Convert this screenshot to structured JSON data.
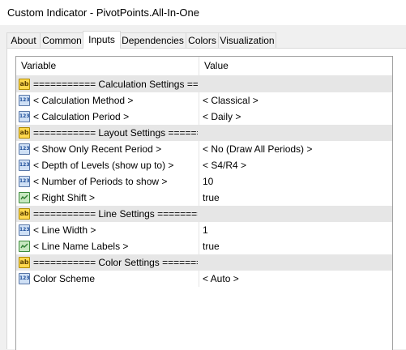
{
  "window": {
    "title": "Custom Indicator - PivotPoints.All-In-One"
  },
  "tabs": [
    {
      "label": "About",
      "active": false
    },
    {
      "label": "Common",
      "active": false
    },
    {
      "label": "Inputs",
      "active": true
    },
    {
      "label": "Dependencies",
      "active": false
    },
    {
      "label": "Colors",
      "active": false
    },
    {
      "label": "Visualization",
      "active": false
    }
  ],
  "grid": {
    "headers": {
      "variable": "Variable",
      "value": "Value"
    },
    "rows": [
      {
        "type": "str",
        "icon": "string-type-icon",
        "icon_text": "ab",
        "name": "=========== Calculation Settings ====...",
        "value": ""
      },
      {
        "type": "num",
        "icon": "numeric-type-icon",
        "icon_text": "123",
        "name": "< Calculation Method >",
        "value": "< Classical >"
      },
      {
        "type": "num",
        "icon": "numeric-type-icon",
        "icon_text": "123",
        "name": "< Calculation Period >",
        "value": "< Daily >"
      },
      {
        "type": "str",
        "icon": "string-type-icon",
        "icon_text": "ab",
        "name": "=========== Layout Settings =======...",
        "value": ""
      },
      {
        "type": "num",
        "icon": "numeric-type-icon",
        "icon_text": "123",
        "name": "< Show Only Recent Period >",
        "value": "< No (Draw All Periods) >"
      },
      {
        "type": "num",
        "icon": "numeric-type-icon",
        "icon_text": "123",
        "name": "< Depth of Levels (show up to) >",
        "value": "< S4/R4 >"
      },
      {
        "type": "num",
        "icon": "numeric-type-icon",
        "icon_text": "123",
        "name": "< Number of Periods to show >",
        "value": "10"
      },
      {
        "type": "bool",
        "icon": "boolean-type-icon",
        "icon_text": "",
        "name": "< Right Shift >",
        "value": "true"
      },
      {
        "type": "str",
        "icon": "string-type-icon",
        "icon_text": "ab",
        "name": "=========== Line Settings =========...",
        "value": ""
      },
      {
        "type": "num",
        "icon": "numeric-type-icon",
        "icon_text": "123",
        "name": "< Line Width >",
        "value": "1"
      },
      {
        "type": "bool",
        "icon": "boolean-type-icon",
        "icon_text": "",
        "name": "< Line Name Labels >",
        "value": "true"
      },
      {
        "type": "str",
        "icon": "string-type-icon",
        "icon_text": "ab",
        "name": "=========== Color Settings ========...",
        "value": ""
      },
      {
        "type": "num",
        "icon": "numeric-type-icon",
        "icon_text": "123",
        "name": "Color Scheme",
        "value": "< Auto >"
      }
    ]
  }
}
